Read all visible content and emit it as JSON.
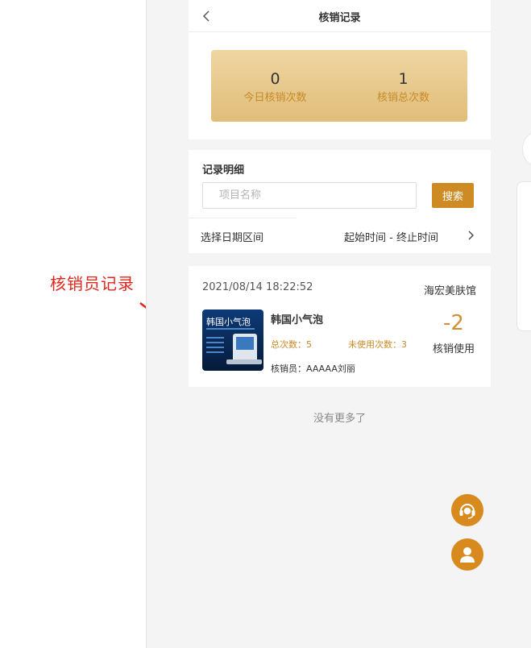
{
  "annotation": {
    "label": "核销员记录"
  },
  "header": {
    "title": "核销记录"
  },
  "summary": {
    "today_value": "0",
    "today_label": "今日核销次数",
    "total_value": "1",
    "total_label": "核销总次数"
  },
  "filter": {
    "heading": "记录明细",
    "search_placeholder": "项目名称",
    "search_button": "搜索",
    "date_label": "选择日期区间",
    "date_range": "起始时间 - 终止时间"
  },
  "records": [
    {
      "time": "2021/08/14 18:22:52",
      "store": "海宏美肤馆",
      "name": "韩国小气泡",
      "thumb_title": "韩国小气泡",
      "total_count": "总次数：5",
      "unused_count": "未使用次数：3",
      "operator": "核销员：AAAAA刘丽",
      "delta": "-2",
      "type": "核销使用"
    }
  ],
  "footer": {
    "no_more": "没有更多了"
  },
  "colors": {
    "accent": "#cf8b23",
    "annotation_red": "#e0261c",
    "summary_gradient_top": "#eed6a2",
    "summary_gradient_bottom": "#e1bd79"
  }
}
